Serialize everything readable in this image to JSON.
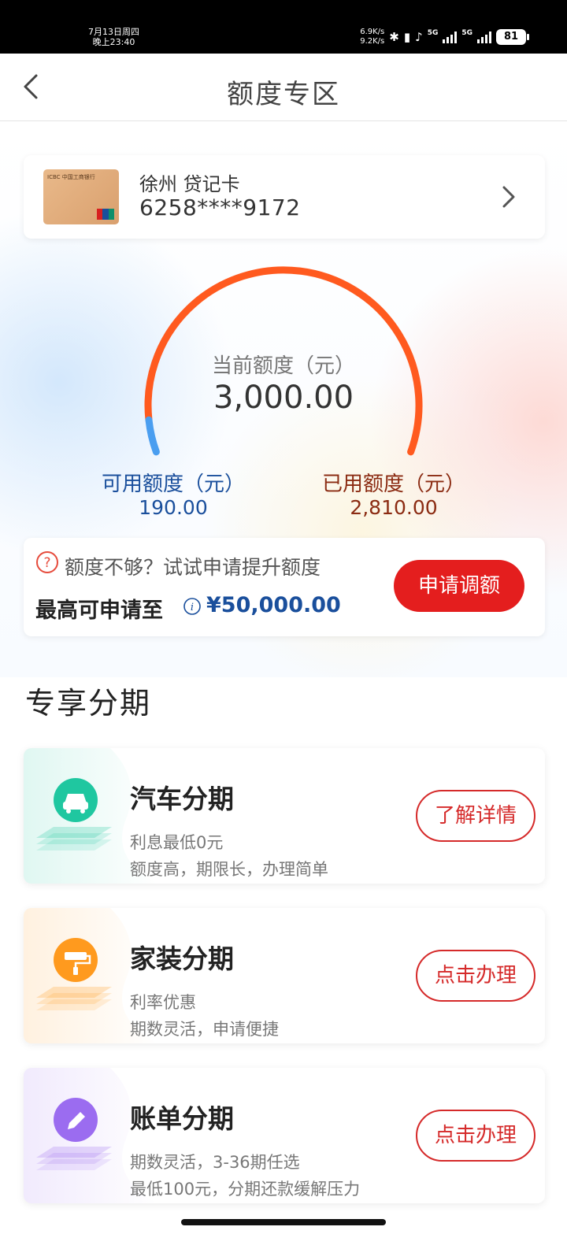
{
  "status_bar": {
    "date": "7月13日周四",
    "time": "晚上23:40",
    "speed_up": "6.9K/s",
    "speed_down": "9.2K/s",
    "network1": "5G",
    "network2": "5G",
    "battery": "81"
  },
  "header": {
    "title": "额度专区"
  },
  "card": {
    "bank_mini": "ICBC 中国工商银行",
    "name": "徐州 贷记卡",
    "number": "6258****9172"
  },
  "quota": {
    "current_label": "当前额度（元）",
    "current_value": "3,000.00",
    "available_label": "可用额度（元）",
    "available_value": "190.00",
    "used_label": "已用额度（元）",
    "used_value": "2,810.00",
    "available_fraction": 0.0633,
    "colors": {
      "available": "#4a9ef0",
      "used": "#ff5a1f"
    }
  },
  "raise": {
    "hint": "额度不够？试试申请提升额度",
    "max_label": "最高可申请至",
    "max_value": "¥50,000.00",
    "button": "申请调额"
  },
  "section": {
    "title": "专享分期"
  },
  "installments": [
    {
      "title": "汽车分期",
      "desc1": "利息最低0元",
      "desc2": "额度高，期限长，办理简单",
      "button": "了解详情",
      "icon": "car-icon",
      "color": "#1fc7a0"
    },
    {
      "title": "家装分期",
      "desc1": "利率优惠",
      "desc2": "期数灵活，申请便捷",
      "button": "点击办理",
      "icon": "paint-roller-icon",
      "color": "#ff9a1e"
    },
    {
      "title": "账单分期",
      "desc1": "期数灵活，3-36期任选",
      "desc2": "最低100元，分期还款缓解压力",
      "button": "点击办理",
      "icon": "pencil-icon",
      "color": "#9b6cf0"
    }
  ]
}
